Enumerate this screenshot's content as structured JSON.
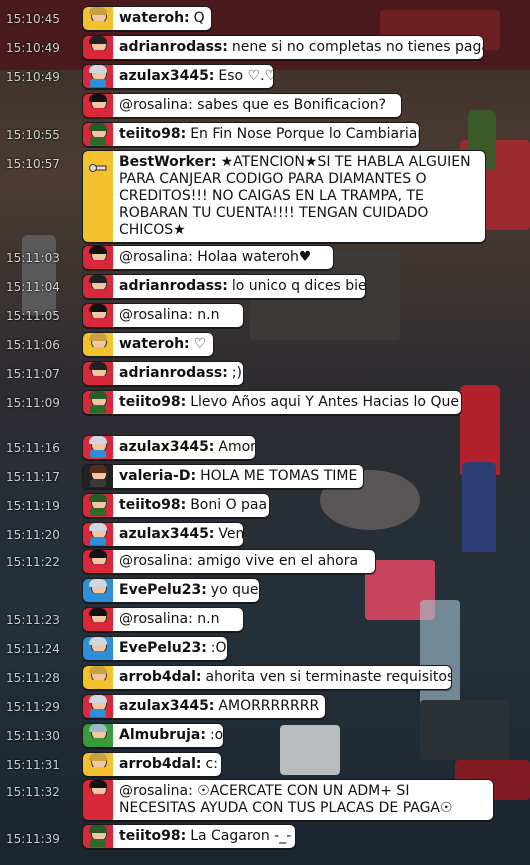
{
  "colors": {
    "red": "#d8283a",
    "yellow": "#f3c02e",
    "blue": "#2f8ed8",
    "green": "#3a9a3a",
    "black": "#222222",
    "white_body": "#ffffff",
    "staff_body": "#2f3a4a"
  },
  "timestamps": [
    "15:10:45",
    "15:10:49",
    "15:10:49",
    "15:10:55",
    "15:10:57",
    "15:11:03",
    "15:11:04",
    "15:11:05",
    "15:11:06",
    "15:11:07",
    "15:11:09",
    "15:11:16",
    "15:11:17",
    "15:11:19",
    "15:11:20",
    "15:11:22",
    "15:11:23",
    "15:11:24",
    "15:11:28",
    "15:11:29",
    "15:11:30",
    "15:11:31",
    "15:11:32",
    "15:11:39"
  ],
  "messages": [
    {
      "name": "wateroh:",
      "text": "Q",
      "color": "yellow"
    },
    {
      "name": "adrianrodass:",
      "text": "nene si no completas no tienes paga",
      "color": "red"
    },
    {
      "name": "azulax3445:",
      "text": "Eso ♡.♡",
      "color": "red"
    },
    {
      "name": "",
      "text": "@rosalina: sabes que es Bonificacion?",
      "color": "red"
    },
    {
      "name": "teiito98:",
      "text": "En Fin Nose Porque lo Cambiarian",
      "color": "red"
    },
    {
      "name": "BestWorker:",
      "text": "★ATENCION★SI TE HABLA ALGUIEN PARA CANJEAR CODIGO PARA DIAMANTES O CREDITOS!!! NO CAIGAS EN LA TRAMPA, TE ROBARAN TU CUENTA!!!! TENGAN CUIDADO CHICOS★",
      "color": "yellow"
    },
    {
      "name": "",
      "text": "@rosalina: Holaa wateroh♥",
      "color": "red"
    },
    {
      "name": "adrianrodass:",
      "text": "lo unico q dices bien",
      "color": "red"
    },
    {
      "name": "",
      "text": "@rosalina: n.n",
      "color": "red"
    },
    {
      "name": "wateroh:",
      "text": "♡",
      "color": "yellow"
    },
    {
      "name": "adrianrodass:",
      "text": ";)",
      "color": "red"
    },
    {
      "name": "teiito98:",
      "text": "Llevo Años aqui Y Antes Hacias lo Que Quisieras",
      "color": "red"
    },
    {
      "name": "azulax3445:",
      "text": "Amor",
      "color": "red"
    },
    {
      "name": "valeria-D:",
      "text": "HOLA ME TOMAS TIME",
      "color": "black"
    },
    {
      "name": "teiito98:",
      "text": "Boni O paa",
      "color": "red"
    },
    {
      "name": "azulax3445:",
      "text": "Ven",
      "color": "red"
    },
    {
      "name": "",
      "text": "@rosalina: amigo vive en el ahora",
      "color": "red"
    },
    {
      "name": "EvePelu23:",
      "text": "yo que",
      "color": "blue"
    },
    {
      "name": "",
      "text": "@rosalina: n.n",
      "color": "red"
    },
    {
      "name": "EvePelu23:",
      "text": ":O",
      "color": "blue"
    },
    {
      "name": "arrob4dal:",
      "text": "ahorita ven si terminaste requisitos",
      "color": "yellow"
    },
    {
      "name": "azulax3445:",
      "text": "AMORRRRRRR",
      "color": "red"
    },
    {
      "name": "Almubruja:",
      "text": ":o",
      "color": "green"
    },
    {
      "name": "arrob4dal:",
      "text": "c:",
      "color": "yellow"
    },
    {
      "name": "",
      "text": "@rosalina: ☉ACERCATE CON UN ADM+ SI NECESITAS AYUDA CON TUS PLACAS DE PAGA☉",
      "color": "red"
    },
    {
      "name": "teiito98:",
      "text": "La Cagaron -_-",
      "color": "red"
    }
  ]
}
